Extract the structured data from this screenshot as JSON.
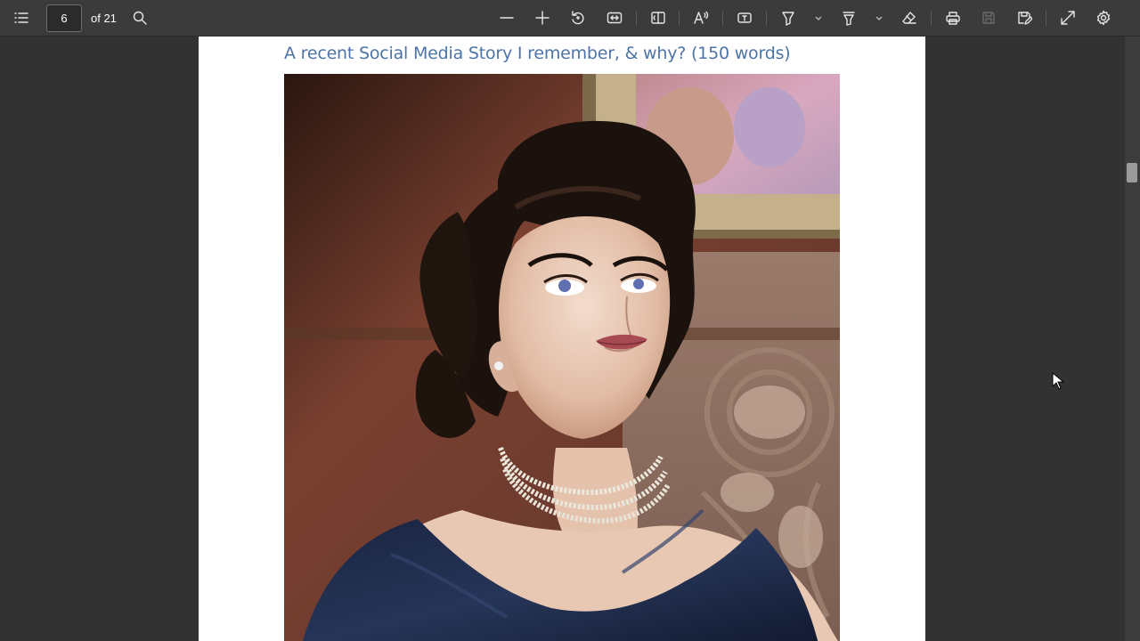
{
  "toolbar": {
    "contents_icon": "list-icon",
    "page_number": "6",
    "page_total": "of 21",
    "search_icon": "search-icon",
    "buttons": [
      "zoom-out-icon",
      "zoom-in-icon",
      "rotate-icon",
      "fit-width-icon",
      "page-view-icon",
      "read-aloud-icon",
      "text-box-icon",
      "draw-icon",
      "highlight-icon",
      "erase-icon",
      "print-icon",
      "save-icon",
      "save-as-icon",
      "fullscreen-icon",
      "settings-icon"
    ]
  },
  "document": {
    "heading": "A recent Social Media Story I remember, & why? (150 words)",
    "image_description": "Colorized vintage portrait photograph of a woman with dark curled hair wearing a pearl necklace and navy off-shoulder dress"
  },
  "colors": {
    "toolbar_bg": "#3b3b3b",
    "viewer_bg": "#323232",
    "heading_color": "#4d74a8"
  }
}
